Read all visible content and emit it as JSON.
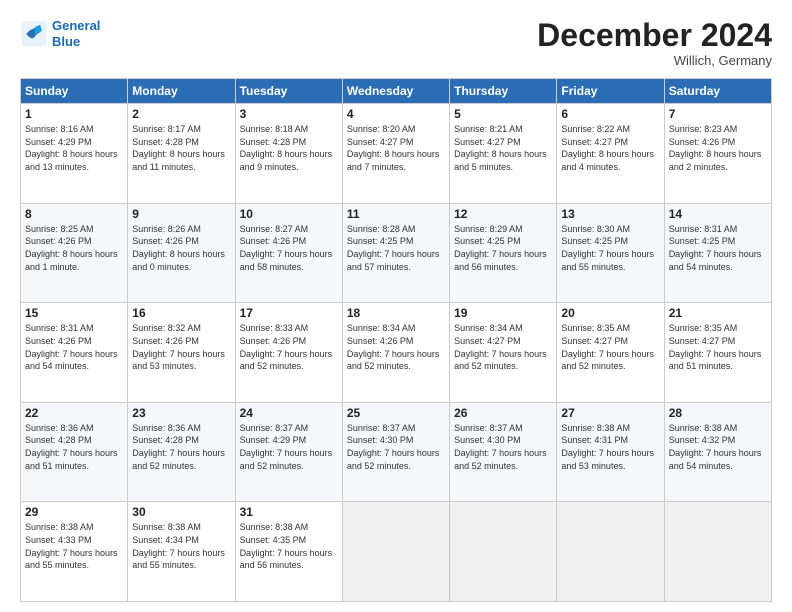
{
  "logo": {
    "line1": "General",
    "line2": "Blue"
  },
  "header": {
    "title": "December 2024",
    "subtitle": "Willich, Germany"
  },
  "weekdays": [
    "Sunday",
    "Monday",
    "Tuesday",
    "Wednesday",
    "Thursday",
    "Friday",
    "Saturday"
  ],
  "weeks": [
    [
      {
        "day": "1",
        "sunrise": "8:16 AM",
        "sunset": "4:29 PM",
        "daylight": "8 hours and 13 minutes."
      },
      {
        "day": "2",
        "sunrise": "8:17 AM",
        "sunset": "4:28 PM",
        "daylight": "8 hours and 11 minutes."
      },
      {
        "day": "3",
        "sunrise": "8:18 AM",
        "sunset": "4:28 PM",
        "daylight": "8 hours and 9 minutes."
      },
      {
        "day": "4",
        "sunrise": "8:20 AM",
        "sunset": "4:27 PM",
        "daylight": "8 hours and 7 minutes."
      },
      {
        "day": "5",
        "sunrise": "8:21 AM",
        "sunset": "4:27 PM",
        "daylight": "8 hours and 5 minutes."
      },
      {
        "day": "6",
        "sunrise": "8:22 AM",
        "sunset": "4:27 PM",
        "daylight": "8 hours and 4 minutes."
      },
      {
        "day": "7",
        "sunrise": "8:23 AM",
        "sunset": "4:26 PM",
        "daylight": "8 hours and 2 minutes."
      }
    ],
    [
      {
        "day": "8",
        "sunrise": "8:25 AM",
        "sunset": "4:26 PM",
        "daylight": "8 hours and 1 minute."
      },
      {
        "day": "9",
        "sunrise": "8:26 AM",
        "sunset": "4:26 PM",
        "daylight": "8 hours and 0 minutes."
      },
      {
        "day": "10",
        "sunrise": "8:27 AM",
        "sunset": "4:26 PM",
        "daylight": "7 hours and 58 minutes."
      },
      {
        "day": "11",
        "sunrise": "8:28 AM",
        "sunset": "4:25 PM",
        "daylight": "7 hours and 57 minutes."
      },
      {
        "day": "12",
        "sunrise": "8:29 AM",
        "sunset": "4:25 PM",
        "daylight": "7 hours and 56 minutes."
      },
      {
        "day": "13",
        "sunrise": "8:30 AM",
        "sunset": "4:25 PM",
        "daylight": "7 hours and 55 minutes."
      },
      {
        "day": "14",
        "sunrise": "8:31 AM",
        "sunset": "4:25 PM",
        "daylight": "7 hours and 54 minutes."
      }
    ],
    [
      {
        "day": "15",
        "sunrise": "8:31 AM",
        "sunset": "4:26 PM",
        "daylight": "7 hours and 54 minutes."
      },
      {
        "day": "16",
        "sunrise": "8:32 AM",
        "sunset": "4:26 PM",
        "daylight": "7 hours and 53 minutes."
      },
      {
        "day": "17",
        "sunrise": "8:33 AM",
        "sunset": "4:26 PM",
        "daylight": "7 hours and 52 minutes."
      },
      {
        "day": "18",
        "sunrise": "8:34 AM",
        "sunset": "4:26 PM",
        "daylight": "7 hours and 52 minutes."
      },
      {
        "day": "19",
        "sunrise": "8:34 AM",
        "sunset": "4:27 PM",
        "daylight": "7 hours and 52 minutes."
      },
      {
        "day": "20",
        "sunrise": "8:35 AM",
        "sunset": "4:27 PM",
        "daylight": "7 hours and 52 minutes."
      },
      {
        "day": "21",
        "sunrise": "8:35 AM",
        "sunset": "4:27 PM",
        "daylight": "7 hours and 51 minutes."
      }
    ],
    [
      {
        "day": "22",
        "sunrise": "8:36 AM",
        "sunset": "4:28 PM",
        "daylight": "7 hours and 51 minutes."
      },
      {
        "day": "23",
        "sunrise": "8:36 AM",
        "sunset": "4:28 PM",
        "daylight": "7 hours and 52 minutes."
      },
      {
        "day": "24",
        "sunrise": "8:37 AM",
        "sunset": "4:29 PM",
        "daylight": "7 hours and 52 minutes."
      },
      {
        "day": "25",
        "sunrise": "8:37 AM",
        "sunset": "4:30 PM",
        "daylight": "7 hours and 52 minutes."
      },
      {
        "day": "26",
        "sunrise": "8:37 AM",
        "sunset": "4:30 PM",
        "daylight": "7 hours and 52 minutes."
      },
      {
        "day": "27",
        "sunrise": "8:38 AM",
        "sunset": "4:31 PM",
        "daylight": "7 hours and 53 minutes."
      },
      {
        "day": "28",
        "sunrise": "8:38 AM",
        "sunset": "4:32 PM",
        "daylight": "7 hours and 54 minutes."
      }
    ],
    [
      {
        "day": "29",
        "sunrise": "8:38 AM",
        "sunset": "4:33 PM",
        "daylight": "7 hours and 55 minutes."
      },
      {
        "day": "30",
        "sunrise": "8:38 AM",
        "sunset": "4:34 PM",
        "daylight": "7 hours and 55 minutes."
      },
      {
        "day": "31",
        "sunrise": "8:38 AM",
        "sunset": "4:35 PM",
        "daylight": "7 hours and 56 minutes."
      },
      null,
      null,
      null,
      null
    ]
  ]
}
